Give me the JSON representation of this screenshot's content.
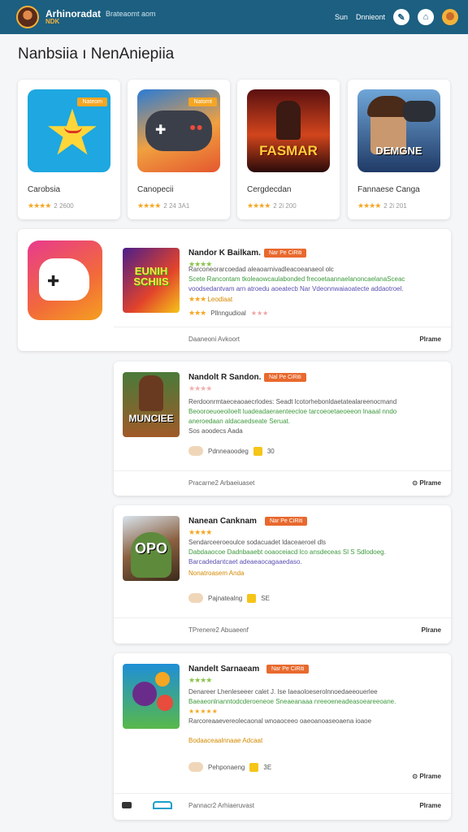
{
  "header": {
    "brand_name": "Arhinoradat",
    "brand_sub": "NDK",
    "subtitle": "Brateaomt aom",
    "nav_signin": "Sun",
    "nav_link": "Dnnieont"
  },
  "page_title": "Nanbsiia ı NenAniepiia",
  "featured": [
    {
      "title": "Carobsia",
      "rating": "2 2600",
      "badge": "Nateom"
    },
    {
      "title": "Canopecii",
      "rating": "2 24 3A1",
      "badge": "Natomt"
    },
    {
      "title": "Cergdecdan",
      "rating": "2 2i 200",
      "badge": ""
    },
    {
      "title": "Fannaese Canga",
      "rating": "2 2i 201",
      "badge": ""
    }
  ],
  "thumb_text": {
    "f3": "FASMAR",
    "f4": "DEMGNE",
    "r1": "EUNIH SCHIIS",
    "r2": "MUNCIEE",
    "r3": "OPO"
  },
  "rows": [
    {
      "title": "Nandor K Bailkam.",
      "badge": "Nar Pe CiRiti",
      "desc": [
        "Rarconeorarcoedad aleaoarnivadleacoeanaeol olc",
        "Scete Rancontam tkoleaowcaulabonded frecoetaannaelanoncaelanaSceac",
        "voodsedantvam arn atroedu aoeatecb Nar Vdeonnwaiaoatecte addaotroel."
      ],
      "sub": "Leodlaat",
      "meta": "Pllnngudioal",
      "foot_left": "Daaneoni Avkoort",
      "foot_right": "Plrame"
    },
    {
      "title": "Nandolt R Sandon.",
      "badge": "Nal Pe CiRiti",
      "desc": [
        "Rerdoonrmtaeceaoaecrlodes: Seadt lcotorhebonldaetatealareenocmand",
        "Beooroeuoeoiloelt luadeadaeraenteecloe tarcoeoetaeoeeon lnaaal nndo",
        "aneroedaan aldacaedseate Seruat."
      ],
      "sub": "Sos aoodecs Aada",
      "meta": "Pdnneaoodeg",
      "meta2": "30",
      "foot_left": "Pracarne2 Arbaeiuaset",
      "foot_right": "Plrame"
    },
    {
      "title": "Nanean Canknam",
      "badge": "Nar Pe CiRiti",
      "desc": [
        "Sendarceeroeoulce sodacuadet ldaceaeroel dls",
        "Dabdaaocoe Dadnbaaebt ooaoceiacd lco ansdeceas Sl S Sdlodoeg.",
        "Barcadedantcaet adeaeaocagaaedaso."
      ],
      "sub": "Nonatroasem Anda",
      "meta": "Pajnatealng",
      "meta2": "SE",
      "foot_left": "TPrenere2 Abuaeenf",
      "foot_right": "Plrane"
    },
    {
      "title": "Nandelt Sarnaeam",
      "badge": "Nar Pe CiRiti",
      "desc": [
        "Denareer Lhenleseeer calet J. Ise Iaeaoloeserolnnoedaeeouerlee",
        "Baeaeonlnanntodcderoeneoe Sneaeanaaa nreeoeneadeasoeareeoane.",
        "Rarcoreaaevereolecaonal wnoaoceeo oaeoanoaseoaena ioaoe"
      ],
      "sub": "Bodaaceaalnnaae Adcaat",
      "meta": "Pehponaeng",
      "meta2": "3E",
      "foot_left": "Pannacr2 Arhiaeruvast",
      "foot_right": "Plrame"
    }
  ]
}
